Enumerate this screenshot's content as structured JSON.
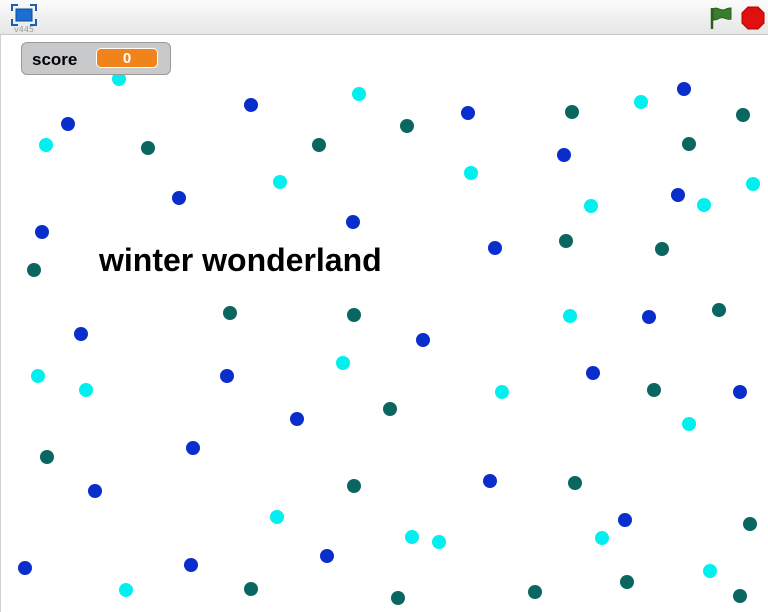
{
  "topbar": {
    "version": "v445",
    "fullscreen_icon": "fullscreen-icon",
    "green_flag_icon": "green-flag-icon",
    "stop_icon": "stop-icon"
  },
  "score_monitor": {
    "label": "score",
    "value": "0"
  },
  "stage": {
    "banner_text": "winter wonderland"
  },
  "colors": {
    "flake_cyan": "#00f0f0",
    "flake_teal": "#0a6660",
    "flake_blue": "#0a2ecc",
    "monitor_value_bg": "#f0841a",
    "flag_green": "#3a7d2c",
    "stop_red": "#e01010"
  }
}
